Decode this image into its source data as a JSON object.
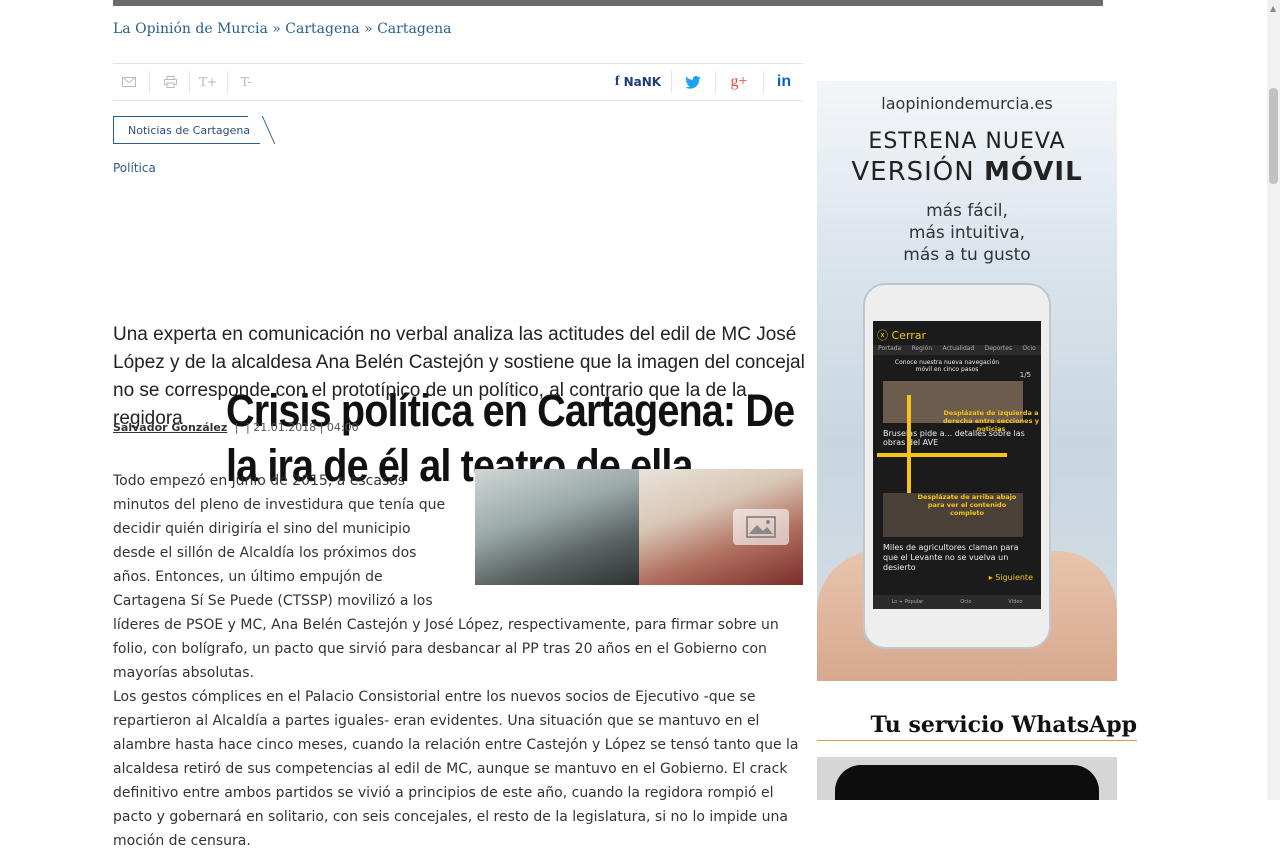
{
  "breadcrumb": {
    "items": [
      "La Opinión de Murcia",
      "Cartagena",
      "Cartagena"
    ],
    "separator": " » "
  },
  "toolbar": {
    "email_icon": "mail-icon",
    "print_icon": "print-icon",
    "font_bigger": "T+",
    "font_smaller": "T-",
    "facebook_count": "NaNK",
    "twitter_icon": "twitter-icon",
    "googleplus_icon": "g+",
    "linkedin_icon": "in"
  },
  "article": {
    "tag": "Noticias de Cartagena",
    "section": "Política",
    "headline": "Crisis política en Cartagena: De la ira de él al teatro de ella",
    "subtitle": "Una experta en comunicación no verbal analiza las actitudes del edil de MC José López y de la alcaldesa Ana Belén Castejón y sostiene que la imagen del concejal no se corresponde con el prototípico de un político, al contrario que la de la regidora",
    "author": "Salvador González",
    "date": "| 21.01.2018 | 04:00",
    "paragraph1": "Todo empezó en junio de 2015, a escasos minutos del pleno de investidura que tenía que decidir quién dirigiría el sino del municipio desde el sillón de Alcaldía los próximos dos años. Entonces, un último empujón de Cartagena Sí Se Puede (CTSSP) movilizó a los líderes de PSOE y MC, Ana Belén Castejón y José López, respectivamente, para firmar sobre un folio, con bolígrafo, un pacto que sirvió para desbancar al PP tras 20 años en el Gobierno con mayorías absolutas.",
    "paragraph2": "Los gestos cómplices en el Palacio Consistorial entre los nuevos socios de Ejecutivo -que se repartieron al Alcaldía a partes iguales- eran evidentes. Una situación que se mantuvo en el alambre hasta hace cinco meses, cuando la relación entre Castejón y López se tensó tanto que la alcaldesa retiró de sus competencias al edil de MC, aunque se mantuvo en el Gobierno. El crack definitivo entre ambos partidos se vivió a principios de este año, cuando la regidora rompió el pacto y gobernará en solitario, con seis concejales, el resto de la legislatura, si no lo impide una moción de censura."
  },
  "ad": {
    "site": "laopiniondemurcia.es",
    "line1": "ESTRENA NUEVA",
    "line2a": "VERSIÓN ",
    "line2b": "MÓVIL",
    "line3": "más fácil,",
    "line4": "más intuitiva,",
    "line5": "más a tu gusto",
    "screen": {
      "close": "Cerrar",
      "tabs": [
        "Portada",
        "Región",
        "Actualidad",
        "Deportes",
        "Ocio"
      ],
      "tip1": "Conoce nuestra nueva navegación móvil en cinco pasos",
      "count": "1/5",
      "tip2": "Desplázate de izquierda a derecha entre secciones y noticias",
      "headline1": "Bruselas pide a... detalles sobre las obras del AVE",
      "tip3": "Desplázate de arriba abajo para ver el contenido completo",
      "headline2": "Miles de agricultores claman para que el Levante no se vuelva un desierto",
      "next": "Siguiente",
      "bottom": [
        "Lo + Popular",
        "Ocio",
        "Vídeo"
      ]
    }
  },
  "whatsapp": {
    "title": "Tu servicio WhatsApp"
  },
  "colors": {
    "link": "#2a5e8c",
    "accent_yellow": "#f6c418",
    "whatsapp_line": "#c9a84a"
  }
}
